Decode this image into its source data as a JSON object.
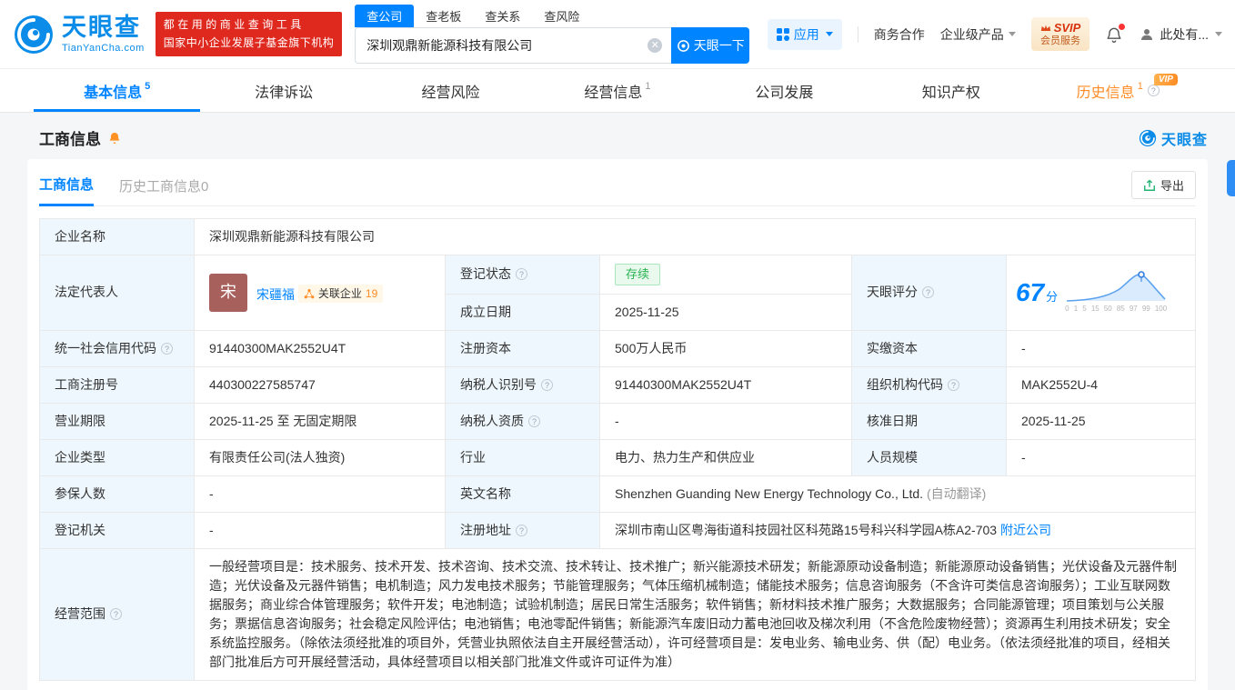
{
  "colors": {
    "accent": "#0084ff",
    "badge_red": "#df281e",
    "vip_orange": "#ff8c26",
    "status_green": "#28b350"
  },
  "brand": {
    "name": "天眼查",
    "domain": "TianYanCha.com",
    "slogan1": "都在用的商业查询工具",
    "slogan2": "国家中小企业发展子基金旗下机构"
  },
  "search": {
    "tabs": [
      {
        "label": "查公司"
      },
      {
        "label": "查老板"
      },
      {
        "label": "查关系"
      },
      {
        "label": "查风险"
      }
    ],
    "value": "深圳观鼎新能源科技有限公司",
    "button": "天眼一下"
  },
  "header_menu": {
    "apps": "应用",
    "cooperation": "商务合作",
    "enterprise": "企业级产品",
    "svip_top": "SVIP",
    "svip_bottom": "会员服务",
    "user": "此处有..."
  },
  "nav_tabs": [
    {
      "label": "基本信息",
      "count": "5"
    },
    {
      "label": "法律诉讼",
      "count": ""
    },
    {
      "label": "经营风险",
      "count": ""
    },
    {
      "label": "经营信息",
      "count": "1"
    },
    {
      "label": "公司发展",
      "count": ""
    },
    {
      "label": "知识产权",
      "count": ""
    },
    {
      "label": "历史信息",
      "count": "1",
      "vip": "VIP"
    }
  ],
  "section": {
    "title": "工商信息",
    "watermark": "天眼查"
  },
  "card": {
    "tab_current": "工商信息",
    "tab_history": "历史工商信息",
    "tab_history_count": "0",
    "export": "导出"
  },
  "score": {
    "value": "67",
    "unit": "分",
    "axis": [
      "0",
      "1",
      "5",
      "15",
      "50",
      "85",
      "97",
      "99",
      "100"
    ]
  },
  "table": {
    "labels": {
      "name": "企业名称",
      "legal_rep": "法定代表人",
      "reg_status": "登记状态",
      "est_date": "成立日期",
      "score": "天眼评分",
      "credit_code": "统一社会信用代码",
      "reg_capital": "注册资本",
      "paid_capital": "实缴资本",
      "reg_number": "工商注册号",
      "taxpayer_id": "纳税人识别号",
      "org_code": "组织机构代码",
      "business_term": "营业期限",
      "taxpayer_quality": "纳税人资质",
      "approval_date": "核准日期",
      "company_type": "企业类型",
      "industry": "行业",
      "staff_size": "人员规模",
      "insured_count": "参保人数",
      "english_name": "英文名称",
      "reg_authority": "登记机关",
      "reg_address": "注册地址",
      "business_scope": "经营范围"
    },
    "values": {
      "name": "深圳观鼎新能源科技有限公司",
      "legal_rep_avatar": "宋",
      "legal_rep_name": "宋疆福",
      "related_label": "关联企业",
      "related_count": "19",
      "reg_status": "存续",
      "est_date": "2025-11-25",
      "credit_code": "91440300MAK2552U4T",
      "reg_capital": "500万人民币",
      "paid_capital": "-",
      "reg_number": "440300227585747",
      "taxpayer_id": "91440300MAK2552U4T",
      "org_code": "MAK2552U-4",
      "business_term": "2025-11-25 至 无固定期限",
      "taxpayer_quality": "-",
      "approval_date": "2025-11-25",
      "company_type": "有限责任公司(法人独资)",
      "industry": "电力、热力生产和供应业",
      "staff_size": "-",
      "insured_count": "-",
      "english_name": "Shenzhen Guanding New Energy Technology Co., Ltd.",
      "english_name_note": "(自动翻译)",
      "reg_authority": "-",
      "reg_address": "深圳市南山区粤海街道科技园社区科苑路15号科兴科学园A栋A2-703",
      "nearby_link": "附近公司",
      "business_scope": "一般经营项目是：技术服务、技术开发、技术咨询、技术交流、技术转让、技术推广；新兴能源技术研发；新能源原动设备制造；新能源原动设备销售；光伏设备及元器件制造；光伏设备及元器件销售；电机制造；风力发电技术服务；节能管理服务；气体压缩机械制造；储能技术服务；信息咨询服务（不含许可类信息咨询服务）；工业互联网数据服务；商业综合体管理服务；软件开发；电池制造；试验机制造；居民日常生活服务；软件销售；新材料技术推广服务；大数据服务；合同能源管理；项目策划与公关服务；票据信息咨询服务；社会稳定风险评估；电池销售；电池零配件销售；新能源汽车废旧动力蓄电池回收及梯次利用（不含危险废物经营）；资源再生利用技术研发；安全系统监控服务。（除依法须经批准的项目外，凭营业执照依法自主开展经营活动），许可经营项目是：发电业务、输电业务、供（配）电业务。（依法须经批准的项目，经相关部门批准后方可开展经营活动，具体经营项目以相关部门批准文件或许可证件为准）"
    }
  }
}
